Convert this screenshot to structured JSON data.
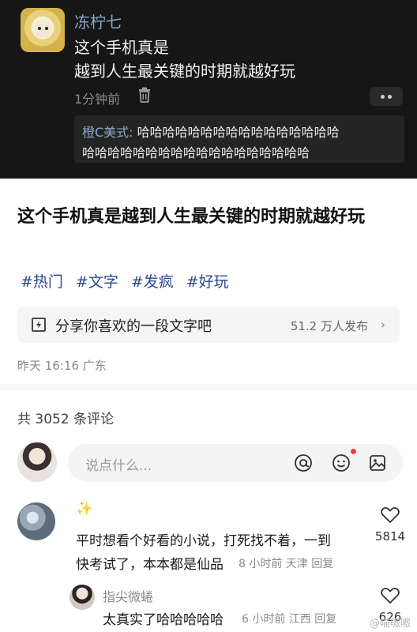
{
  "screenshot": {
    "username": "冻柠七",
    "post_line1": "这个手机真是",
    "post_line2": "越到人生最关键的时期就越好玩",
    "time": "1分钟前",
    "reply_name": "橙C美式:",
    "reply_line1": " 哈哈哈哈哈哈哈哈哈哈哈哈哈哈哈哈",
    "reply_line2": "哈哈哈哈哈哈哈哈哈哈哈哈哈哈哈哈哈哈"
  },
  "post": {
    "title": "这个手机真是越到人生最关键的时期就越好玩",
    "tags": [
      "#热门",
      "#文字",
      "#发疯",
      "#好玩"
    ],
    "share_text": "分享你喜欢的一段文字吧",
    "share_count": "51.2 万人发布",
    "meta": "昨天 16:16 广东"
  },
  "comments_header": "共 3052 条评论",
  "composer": {
    "placeholder": "说点什么..."
  },
  "comments": [
    {
      "line1": "平时想看个好看的小说，打死找不着，一到",
      "line2": "快考试了，本本都是仙品",
      "meta": "8 小时前 天津 回复",
      "likes": "5814"
    }
  ],
  "reply": {
    "name": "指尖微蜷",
    "text": "太真实了哈哈哈哈哈",
    "meta": "6 小时前 江西 回复",
    "likes": "626"
  },
  "watermark": "@喵嗷嗷"
}
